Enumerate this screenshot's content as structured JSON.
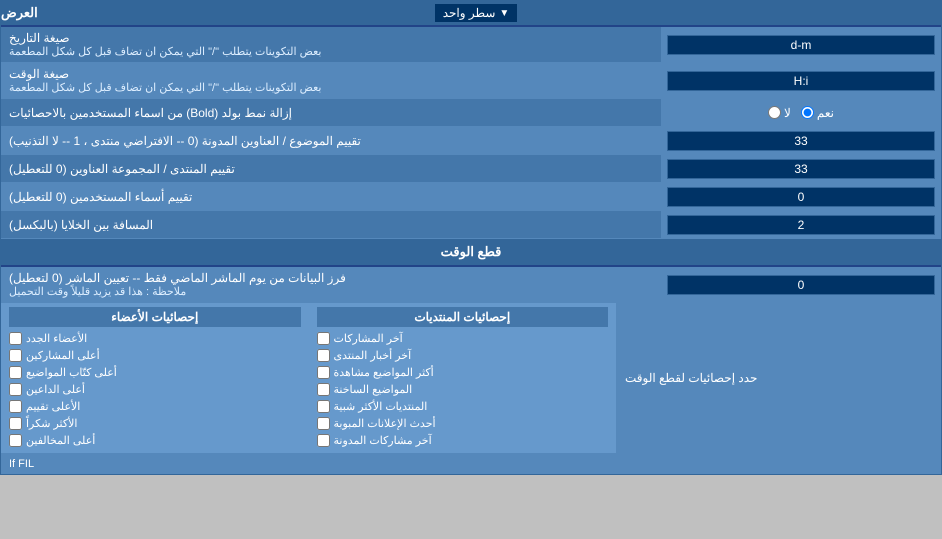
{
  "header": {
    "title": "العرض",
    "dropdown_label": "سطر واحد",
    "dropdown_arrow": "▼"
  },
  "rows": [
    {
      "id": "date_format",
      "label": "صيغة التاريخ",
      "sublabel": "بعض التكوينات يتطلب \"/\" التي يمكن ان تضاف قبل كل شكل المطعمة",
      "input_value": "d-m",
      "type": "text"
    },
    {
      "id": "time_format",
      "label": "صيغة الوقت",
      "sublabel": "بعض التكوينات يتطلب \"/\" التي يمكن ان تضاف قبل كل شكل المطعمة",
      "input_value": "H:i",
      "type": "text"
    },
    {
      "id": "bold_remove",
      "label": "إزالة نمط بولد (Bold) من اسماء المستخدمين بالاحصائيات",
      "type": "radio",
      "options": [
        {
          "value": "yes",
          "label": "نعم"
        },
        {
          "value": "no",
          "label": "لا"
        }
      ],
      "selected": "yes"
    },
    {
      "id": "topic_order",
      "label": "تقييم الموضوع / العناوين المدونة (0 -- الافتراضي منتدى ، 1 -- لا التذنيب)",
      "input_value": "33",
      "type": "text"
    },
    {
      "id": "forum_order",
      "label": "تقييم المنتدى / المجموعة العناوين (0 للتعطيل)",
      "input_value": "33",
      "type": "text"
    },
    {
      "id": "user_names",
      "label": "تقييم أسماء المستخدمين (0 للتعطيل)",
      "input_value": "0",
      "type": "text"
    },
    {
      "id": "cell_spacing",
      "label": "المسافة بين الخلايا (بالبكسل)",
      "input_value": "2",
      "type": "text"
    }
  ],
  "cut_section": {
    "title": "قطع الوقت",
    "row": {
      "id": "cut_days",
      "label_main": "فرز البيانات من يوم الماشر الماضي فقط -- تعيين الماشر (0 لتعطيل)",
      "label_sub": "ملاحظة : هذا قد يزيد قليلاً وقت التحميل",
      "input_value": "0",
      "type": "text"
    },
    "apply_label": "حدد إحصائيات لقطع الوقت"
  },
  "stats_columns": [
    {
      "header": "إحصائيات المنتديات",
      "items": [
        {
          "label": "آخر المشاركات",
          "checked": false
        },
        {
          "label": "آخر أخبار المنتدى",
          "checked": false
        },
        {
          "label": "أكثر المواضيع مشاهدة",
          "checked": false
        },
        {
          "label": "المواضيع الساخنة",
          "checked": false
        },
        {
          "label": "المنتديات الأكثر شبية",
          "checked": false
        },
        {
          "label": "أحدث الإعلانات المبوبة",
          "checked": false
        },
        {
          "label": "آخر مشاركات المدونة",
          "checked": false
        }
      ]
    },
    {
      "header": "إحصائيات الأعضاء",
      "items": [
        {
          "label": "الأعضاء الجدد",
          "checked": false
        },
        {
          "label": "أعلى المشاركين",
          "checked": false
        },
        {
          "label": "أعلى كتّاب المواضيع",
          "checked": false
        },
        {
          "label": "أعلى الداعين",
          "checked": false
        },
        {
          "label": "الأعلى تقييم",
          "checked": false
        },
        {
          "label": "الأكثر شكراً",
          "checked": false
        },
        {
          "label": "أعلى المخالفين",
          "checked": false
        }
      ]
    }
  ],
  "bottom_note": "If FIL"
}
